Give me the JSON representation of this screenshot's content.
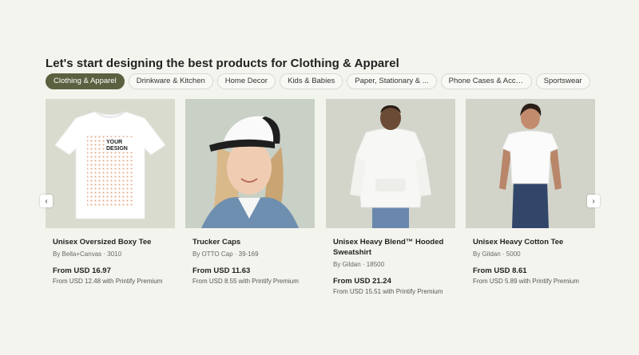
{
  "heading": "Let's start designing the best products for Clothing & Apparel",
  "categories": [
    {
      "label": "Clothing & Apparel",
      "active": true
    },
    {
      "label": "Drinkware & Kitchen",
      "active": false
    },
    {
      "label": "Home Decor",
      "active": false
    },
    {
      "label": "Kids & Babies",
      "active": false
    },
    {
      "label": "Paper, Stationary & ...",
      "active": false
    },
    {
      "label": "Phone Cases & Acce...",
      "active": false
    },
    {
      "label": "Sportswear",
      "active": false
    }
  ],
  "products": [
    {
      "title": "Unisex Oversized Boxy Tee",
      "brand": "By Bella+Canvas · 3010",
      "price": "From USD 16.97",
      "premium": "From USD 12.48 with Printify Premium",
      "design_text": "YOUR\nDESIGN",
      "image_bg": "#d8dbcd"
    },
    {
      "title": "Trucker Caps",
      "brand": "By OTTO Cap · 39-169",
      "price": "From USD 11.63",
      "premium": "From USD 8.55 with Printify Premium",
      "image_bg": "#c9d0c6"
    },
    {
      "title": "Unisex Heavy Blend™ Hooded Sweatshirt",
      "brand": "By Gildan · 18500",
      "price": "From USD 21.24",
      "premium": "From USD 15.51 with Printify Premium",
      "image_bg": "#d3d5cb"
    },
    {
      "title": "Unisex Heavy Cotton Tee",
      "brand": "By Gildan · 5000",
      "price": "From USD 8.61",
      "premium": "From USD 5.89 with Printify Premium",
      "image_bg": "#d2d4ca"
    }
  ],
  "colors": {
    "page_bg": "#f4f4ee",
    "chip_active": "#5b6140"
  },
  "icons": {
    "prev": "chevron-left-icon",
    "next": "chevron-right-icon"
  }
}
